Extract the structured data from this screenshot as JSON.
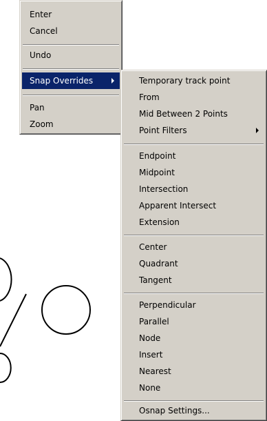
{
  "context_menu": {
    "items": [
      {
        "label": "Enter"
      },
      {
        "label": "Cancel"
      },
      {
        "label": "Undo"
      },
      {
        "label": "Snap Overrides",
        "selected": true,
        "has_submenu": true
      },
      {
        "label": "Pan"
      },
      {
        "label": "Zoom"
      }
    ]
  },
  "snap_submenu": {
    "items": [
      {
        "label": "Temporary track point"
      },
      {
        "label": "From"
      },
      {
        "label": "Mid Between 2 Points"
      },
      {
        "label": "Point Filters",
        "has_submenu": true
      },
      {
        "label": "Endpoint"
      },
      {
        "label": "Midpoint"
      },
      {
        "label": "Intersection"
      },
      {
        "label": "Apparent Intersect"
      },
      {
        "label": "Extension"
      },
      {
        "label": "Center"
      },
      {
        "label": "Quadrant"
      },
      {
        "label": "Tangent"
      },
      {
        "label": "Perpendicular"
      },
      {
        "label": "Parallel"
      },
      {
        "label": "Node"
      },
      {
        "label": "Insert"
      },
      {
        "label": "Nearest"
      },
      {
        "label": "None"
      },
      {
        "label": "Osnap Settings..."
      }
    ]
  },
  "colors": {
    "menu_background": "#d4d0c8",
    "selection_background": "#0a246a",
    "selection_text": "#ffffff",
    "canvas_background": "#ffffff"
  }
}
